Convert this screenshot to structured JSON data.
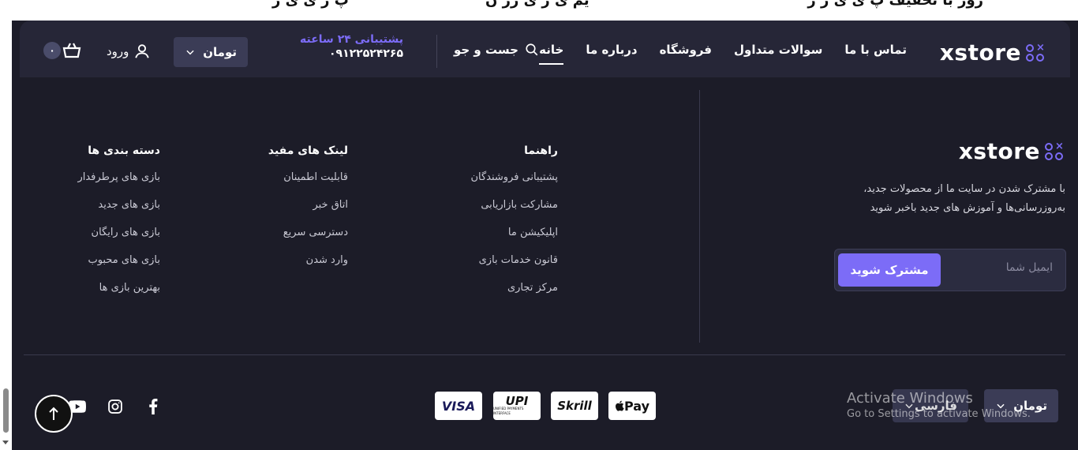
{
  "top_row": {
    "text_right": "روز با تخفیف پ ی ی ر ز",
    "text_mid": "یم ی ر ی رز ن",
    "text_left": "پ ر ی ی ر"
  },
  "header": {
    "logo_text": "xstore",
    "nav": [
      {
        "label": "خانه",
        "active": true
      },
      {
        "label": "درباره ما",
        "active": false
      },
      {
        "label": "فروشگاه",
        "active": false
      },
      {
        "label": "سوالات متداول",
        "active": false
      },
      {
        "label": "تماس با ما",
        "active": false
      }
    ],
    "search_label": "جست و جو",
    "support_label": "پشتیبانی ۲۴ ساعته",
    "support_phone": "۰۹۱۲۲۵۲۴۲۶۵",
    "currency": "تومان",
    "login_label": "ورود",
    "cart_count": "۰"
  },
  "about": {
    "logo_text": "xstore",
    "description": "با مشترک شدن در سایت ما از محصولات جدید، به‌روزرسانی‌ها و آموزش های جدید باخبر شوید",
    "email_placeholder": "ایمیل شما",
    "subscribe_label": "مشترک شوید"
  },
  "columns": {
    "guide": {
      "title": "راهنما",
      "items": [
        "پشتیبانی فروشندگان",
        "مشارکت بازاریابی",
        "اپلیکیشن ما",
        "قانون خدمات بازی",
        "مرکز تجاری"
      ]
    },
    "links": {
      "title": "لینک های مفید",
      "items": [
        "قابلیت اطمینان",
        "اتاق خبر",
        "دسترسی سریع",
        "وارد شدن"
      ]
    },
    "categories": {
      "title": "دسته بندی ها",
      "items": [
        "بازی های پرطرفدار",
        "بازی های جدید",
        "بازی های رایگان",
        "بازی های محبوب",
        "بهترین بازی ها"
      ]
    }
  },
  "bottom": {
    "currency": "تومان",
    "language": "فارسی",
    "payments": [
      "Pay",
      "Skrill",
      "UPI",
      "VISA"
    ],
    "upi_sub": "UNIFIED PAYMENTS INTERFACE"
  },
  "activate_windows": {
    "line1": "Activate Windows",
    "line2": "Go to Settings to activate Windows."
  },
  "colors": {
    "accent": "#7c6cf7",
    "background": "#1c1c28",
    "header": "#262637"
  }
}
